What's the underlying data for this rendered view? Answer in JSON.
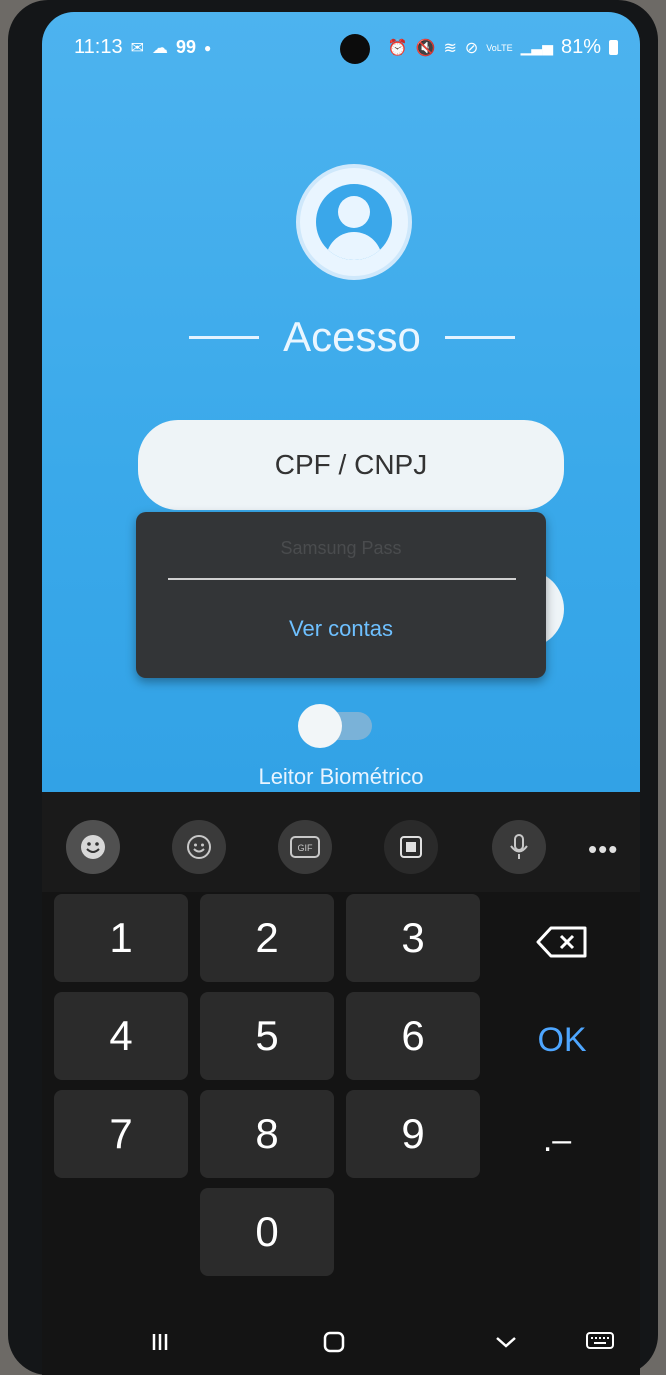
{
  "status": {
    "time": "11:13",
    "extra": "99",
    "lte": "VoLTE",
    "battery": "81%"
  },
  "app": {
    "title": "Acesso",
    "cpf_placeholder": "CPF / CNPJ",
    "suggestion_faded": "Samsung Pass",
    "suggestion_link": "Ver contas",
    "biometric_label": "Leitor Biométrico"
  },
  "toolbar": {
    "icons": [
      "emoji-icon",
      "sticker-icon",
      "gif-icon",
      "clipboard-icon",
      "mic-icon"
    ],
    "more_label": "•••"
  },
  "keypad": {
    "keys": [
      "1",
      "2",
      "3",
      "4",
      "5",
      "6",
      "7",
      "8",
      "9",
      "0"
    ],
    "ok_label": "OK",
    "punct_label": ".–"
  },
  "nav": {
    "icons": [
      "recents-icon",
      "home-icon",
      "back-icon",
      "keyboard-switch-icon"
    ]
  },
  "colors": {
    "app_bg": "#3aa9ea",
    "ok_blue": "#4ea6ff",
    "link_blue": "#6ec0ff"
  }
}
